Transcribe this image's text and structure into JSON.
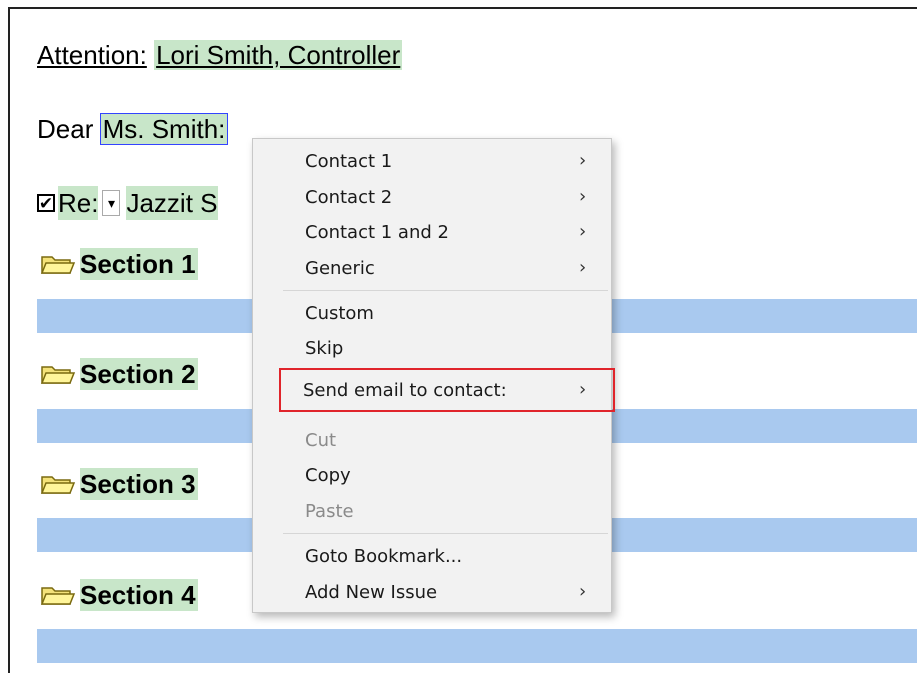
{
  "document": {
    "attention_label": "Attention:",
    "attention_value": "Lori Smith, Controller",
    "dear_label": "Dear",
    "dear_name": "Ms. Smith",
    "dear_suffix": ":",
    "re_label": "Re:",
    "re_value": "Jazzit S",
    "sections": [
      {
        "label": "Section 1"
      },
      {
        "label": "Section 2"
      },
      {
        "label": "Section 3"
      },
      {
        "label": "Section 4"
      }
    ],
    "colors": {
      "field_highlight": "#c8e6c9",
      "band": "#a9c9ef",
      "selection_outline": "#3344ff"
    }
  },
  "context_menu": {
    "items": [
      {
        "label": "Contact 1",
        "submenu": true,
        "disabled": false
      },
      {
        "label": "Contact 2",
        "submenu": true,
        "disabled": false
      },
      {
        "label": "Contact 1 and 2",
        "submenu": true,
        "disabled": false
      },
      {
        "label": "Generic",
        "submenu": true,
        "disabled": false
      },
      {
        "label": "Custom",
        "submenu": false,
        "disabled": false
      },
      {
        "label": "Skip",
        "submenu": false,
        "disabled": false
      },
      {
        "label": "Send email to contact:",
        "submenu": true,
        "disabled": false
      },
      {
        "label": "Cut",
        "submenu": false,
        "disabled": true
      },
      {
        "label": "Copy",
        "submenu": false,
        "disabled": false
      },
      {
        "label": "Paste",
        "submenu": false,
        "disabled": true
      },
      {
        "label": "Goto Bookmark...",
        "submenu": false,
        "disabled": false
      },
      {
        "label": "Add New Issue",
        "submenu": true,
        "disabled": false
      }
    ],
    "chevron_glyph": "›",
    "highlight_color": "#e0242b"
  },
  "icons": {
    "checkbox": "check-icon",
    "checkbox_glyph": "✔",
    "dropdown": "dropdown-arrow-icon",
    "dropdown_glyph": "▾",
    "section": "folder-icon",
    "submenu": "chevron-right-icon"
  }
}
